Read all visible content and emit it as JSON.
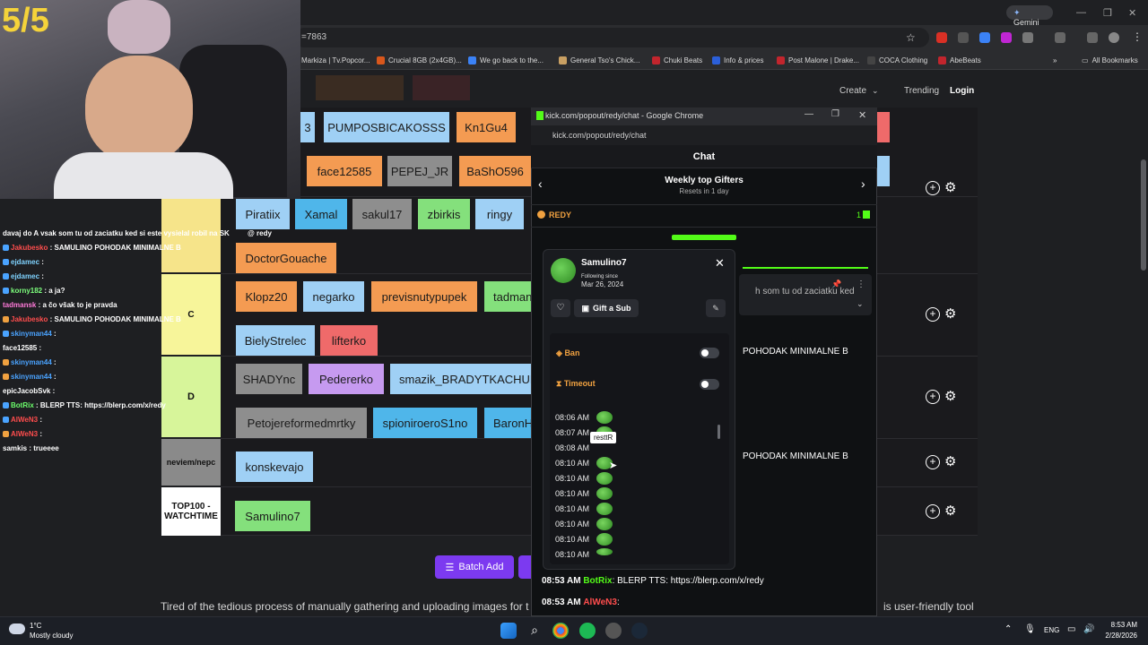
{
  "browser": {
    "url_fragment": "=7863",
    "gemini_label": "Gemini",
    "all_bookmarks": "All Bookmarks",
    "bookmarks": [
      {
        "label": "Markiza | Tv.Popcor...",
        "color": "#e0533d"
      },
      {
        "label": "Crucial 8GB (2x4GB)...",
        "color": "#d9571c"
      },
      {
        "label": "We go back to the...",
        "color": "#3b82f6"
      },
      {
        "label": "General Tso's Chick...",
        "color": "#c9a063"
      },
      {
        "label": "Chuki Beats",
        "color": "#c2252d"
      },
      {
        "label": "Info & prices",
        "color": "#2b5fd9"
      },
      {
        "label": "Post Malone | Drake...",
        "color": "#c2252d"
      },
      {
        "label": "COCA Clothing",
        "color": "#444444"
      },
      {
        "label": "AbeBeats",
        "color": "#c2252d"
      }
    ]
  },
  "site_nav": {
    "create": "Create",
    "trending": "Trending",
    "login": "Login"
  },
  "webcam": {
    "counter": "5/5"
  },
  "tiers": [
    {
      "label": "",
      "color": "#f6e48a",
      "items": [
        {
          "name": "3",
          "color": "c-blue"
        },
        {
          "name": "PUMPOSBICAKOSSS",
          "color": "c-blue"
        },
        {
          "name": "Kn1Gu4",
          "color": "c-orange"
        },
        {
          "name": "face12585",
          "color": "c-orange"
        },
        {
          "name": "PEPEJ_JR",
          "color": "c-grey"
        },
        {
          "name": "BaShO596",
          "color": "c-orange"
        }
      ]
    },
    {
      "label": "",
      "color": "#f6e48a",
      "items": [
        {
          "name": "Piratiix",
          "color": "c-blue"
        },
        {
          "name": "Xamal",
          "color": "c-cyan"
        },
        {
          "name": "sakul17",
          "color": "c-grey"
        },
        {
          "name": "zbirkis",
          "color": "c-green"
        },
        {
          "name": "ringy",
          "color": "c-blue"
        },
        {
          "name": "DoctorGouache",
          "color": "c-orange"
        }
      ]
    },
    {
      "label": "C",
      "color": "#f7f59a",
      "items": [
        {
          "name": "Klopz20",
          "color": "c-orange"
        },
        {
          "name": "negarko",
          "color": "c-blue"
        },
        {
          "name": "previsnutypupek",
          "color": "c-orange"
        },
        {
          "name": "tadmansk",
          "color": "c-green"
        },
        {
          "name": "BielyStrelec",
          "color": "c-blue"
        },
        {
          "name": "lifterko",
          "color": "c-red"
        }
      ]
    },
    {
      "label": "D",
      "color": "#d7f59a",
      "items": [
        {
          "name": "SHADYnc",
          "color": "c-grey"
        },
        {
          "name": "Pedererko",
          "color": "c-violet"
        },
        {
          "name": "smazik_BRADYTKACHUK_",
          "color": "c-blue"
        },
        {
          "name": "Petojereformedmrtky",
          "color": "c-grey"
        },
        {
          "name": "spioniroeroS1no",
          "color": "c-cyan"
        },
        {
          "name": "BaronH",
          "color": "c-cyan"
        }
      ]
    },
    {
      "label": "neviem/nepc",
      "color": "#8a8a8a",
      "items": [
        {
          "name": "konskevajo",
          "color": "c-blue"
        }
      ]
    },
    {
      "label": "TOP100 - WATCHTIME",
      "color": "#ffffff",
      "items": [
        {
          "name": "Samulino7",
          "color": "c-green"
        }
      ]
    }
  ],
  "stream_chat": [
    {
      "user": "",
      "text": "davaj do A vsak som tu od zaciatku ked si este vysielal robil na SK",
      "color": "#ffffff"
    },
    {
      "user": "Jakubesko",
      "text": ": SAMULINO POHODAK MINIMALNE B",
      "color": "#ff4d4d"
    },
    {
      "user": "ejdamec",
      "text": ":",
      "color": "#7fd3ff"
    },
    {
      "user": "ejdamec",
      "text": ":",
      "color": "#7fd3ff"
    },
    {
      "user": "korny182",
      "text": ": a ja?",
      "color": "#7dff7d"
    },
    {
      "user": "tadmansk",
      "text": ": a čo však to je pravda",
      "color": "#ff7ad9"
    },
    {
      "user": "Jakubesko",
      "text": ": SAMULINO POHODAK MINIMALNE B",
      "color": "#ff4d4d"
    },
    {
      "user": "skinyman44",
      "text": ":",
      "color": "#4aa3ff"
    },
    {
      "user": "face12585",
      "text": ":",
      "color": "#ffffff"
    },
    {
      "user": "skinyman44",
      "text": ":",
      "color": "#4aa3ff"
    },
    {
      "user": "skinyman44",
      "text": ":",
      "color": "#4aa3ff"
    },
    {
      "user": "epicJacobSvk",
      "text": ":",
      "color": "#ffffff"
    },
    {
      "user": "BotRix",
      "text": ": BLERP TTS: https://blerp.com/x/redy",
      "color": "#6cff6c"
    },
    {
      "user": "AlWeN3",
      "text": ":",
      "color": "#ff4d4d"
    },
    {
      "user": "AlWeN3",
      "text": ":",
      "color": "#ff4d4d"
    },
    {
      "user": "samkis",
      "text": ": trueeee",
      "color": "#ffffff"
    }
  ],
  "stream_chat_mention": "@ redy",
  "popout": {
    "window_title": "kick.com/popout/redy/chat - Google Chrome",
    "url": "kick.com/popout/redy/chat",
    "chat_header": "Chat",
    "gifters_title": "Weekly top Gifters",
    "gifters_reset": "Resets in 1 day",
    "top_gifter_name": "REDY",
    "top_gifter_count": "1",
    "user_card": {
      "name": "Samulino7",
      "follow_label": "Following since",
      "follow_date": "Mar 26, 2024",
      "gift_label": "Gift a Sub",
      "ban_label": "Ban",
      "timeout_label": "Timeout",
      "tooltip": "resttR",
      "messages": [
        "08:06 AM",
        "08:07 AM",
        "08:08 AM",
        "08:10 AM",
        "08:10 AM",
        "08:10 AM",
        "08:10 AM",
        "08:10 AM",
        "08:10 AM",
        "08:10 AM"
      ]
    },
    "behind_messages": [
      "h som tu od zaciatku ked",
      "POHODAK MINIMALNE B",
      "POHODAK MINIMALNE B"
    ],
    "bottom_messages": [
      {
        "time": "08:53 AM",
        "user": "BotRix",
        "text": ": BLERP TTS: https://blerp.com/x/redy"
      },
      {
        "time": "08:53 AM",
        "user": "AlWeN3",
        "text": ":"
      }
    ]
  },
  "page_bottom": {
    "batch_add": "Batch Add",
    "tagline": "Tired of the tedious process of manually gathering and uploading images for t",
    "tagline_end": "is user-friendly tool"
  },
  "taskbar": {
    "temp": "1°C",
    "weather": "Mostly cloudy",
    "lang": "ENG",
    "time": "8:53 AM",
    "date": "2/28/2026"
  }
}
